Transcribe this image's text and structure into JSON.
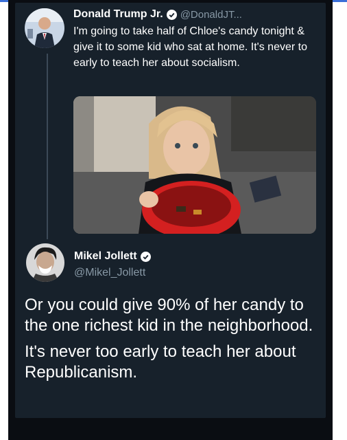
{
  "tweet1": {
    "name": "Donald Trump Jr.",
    "handle": "@DonaldJT...",
    "text": "I'm going to take half of Chloe's candy tonight & give it to some kid who sat at home. It's never to early to teach her about socialism."
  },
  "tweet2": {
    "name": "Mikel Jollett",
    "handle": "@Mikel_Jollett",
    "paragraphs": [
      "Or you could give 90% of her candy to the one richest kid in the neighborhood.",
      "It's never too early to teach her about Republicanism."
    ]
  },
  "colors": {
    "card_background": "#17212b",
    "verified_blue": "#1da1f2",
    "handle_gray": "#8899a6"
  }
}
